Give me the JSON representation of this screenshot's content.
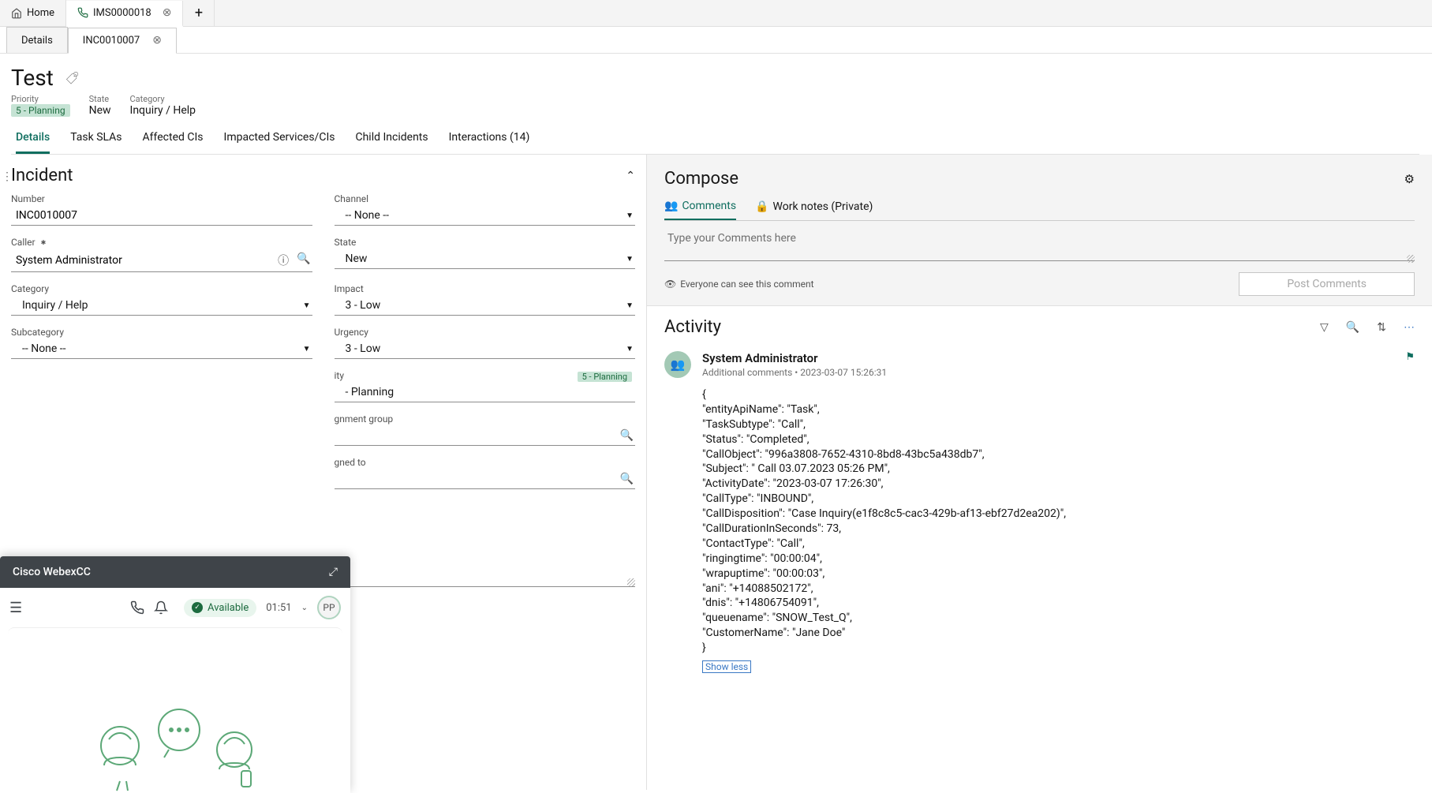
{
  "topTabs": {
    "home": "Home",
    "record": "IMS0000018"
  },
  "secTabs": {
    "details": "Details",
    "incident": "INC0010007"
  },
  "header": {
    "title": "Test",
    "priorityLabel": "Priority",
    "priorityValue": "5 - Planning",
    "stateLabel": "State",
    "stateValue": "New",
    "categoryLabel": "Category",
    "categoryValue": "Inquiry / Help"
  },
  "contentTabs": {
    "details": "Details",
    "taskSlas": "Task SLAs",
    "affectedCis": "Affected CIs",
    "impactedServices": "Impacted Services/CIs",
    "childIncidents": "Child Incidents",
    "interactions": "Interactions (14)"
  },
  "incidentSection": {
    "title": "Incident"
  },
  "form": {
    "numberLabel": "Number",
    "numberValue": "INC0010007",
    "channelLabel": "Channel",
    "channelValue": "-- None --",
    "callerLabel": "Caller",
    "callerValue": "System Administrator",
    "stateLabel": "State",
    "stateValue": "New",
    "categoryLabel": "Category",
    "categoryValue": "Inquiry / Help",
    "impactLabel": "Impact",
    "impactValue": "3 - Low",
    "subcategoryLabel": "Subcategory",
    "subcategoryValue": "-- None --",
    "urgencyLabel": "Urgency",
    "urgencyValue": "3 - Low",
    "priorityPartialLabel": "ity",
    "priorityValue": "- Planning",
    "priorityBadge": "5 - Planning",
    "assignmentGroupLabelPartial": "gnment group",
    "assignedToLabelPartial": "gned to"
  },
  "compose": {
    "title": "Compose",
    "commentsTab": "Comments",
    "workNotesTab": "Work notes (Private)",
    "placeholder": "Type your Comments here",
    "visibilityNote": "Everyone can see this comment",
    "postButton": "Post Comments"
  },
  "activity": {
    "title": "Activity",
    "author": "System Administrator",
    "meta": "Additional comments • 2023-03-07 15:26:31",
    "body": "{\n\"entityApiName\": \"Task\",\n\"TaskSubtype\": \"Call\",\n\"Status\": \"Completed\",\n\"CallObject\": \"996a3808-7652-4310-8bd8-43bc5a438db7\",\n\"Subject\": \" Call 03.07.2023 05:26 PM\",\n\"ActivityDate\": \"2023-03-07 17:26:30\",\n\"CallType\": \"INBOUND\",\n\"CallDisposition\": \"Case Inquiry(e1f8c8c5-cac3-429b-af13-ebf27d2ea202)\",\n\"CallDurationInSeconds\": 73,\n\"ContactType\": \"Call\",\n\"ringingtime\": \"00:00:04\",\n\"wrapuptime\": \"00:00:03\",\n\"ani\": \"+14088502172\",\n\"dnis\": \"+14806754091\",\n\"queuename\": \"SNOW_Test_Q\",\n\"CustomerName\": \"Jane Doe\"\n}",
    "showLess": "Show less"
  },
  "webex": {
    "title": "Cisco WebexCC",
    "status": "Available",
    "timer": "01:51",
    "userInitials": "PP"
  }
}
